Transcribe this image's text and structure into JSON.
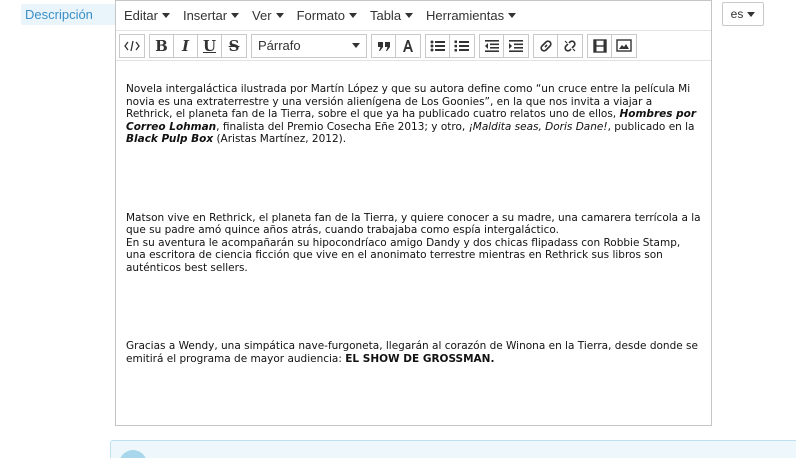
{
  "field_label": "Descripción",
  "menubar": {
    "items": [
      "Editar",
      "Insertar",
      "Ver",
      "Formato",
      "Tabla",
      "Herramientas"
    ]
  },
  "toolbar": {
    "source_code": "source-code-icon",
    "bold": "B",
    "italic": "I",
    "underline": "U",
    "strike": "S",
    "block_format": "Párrafo"
  },
  "content": {
    "p1": {
      "s1": "Novela intergaláctica ilustrada por Martín López y que su autora define como “un cruce entre la película Mi novia es una extraterrestre y una versión alienígena de Los Goonies”, en la que nos invita a viajar a Rethrick, el planeta fan de la Tierra, sobre el que ya ha publicado cuatro relatos uno de ellos, ",
      "b1": "Hombres por Correo Lohman",
      "s2": ", finalista del Premio Cosecha Eñe 2013; y otro, ",
      "i1": "¡Maldita seas, Doris Dane!",
      "s3": ", publicado en la ",
      "b2": "Black Pulp Box",
      "s4": " (Aristas Martínez, 2012)."
    },
    "p2": "Matson vive en Rethrick, el planeta fan de la Tierra, y quiere conocer a su madre, una camarera terrícola a la que su padre amó quince años atrás, cuando trabajaba como espía intergaláctico.",
    "p2b": "En su aventura le acompañarán su hipocondríaco amigo Dandy y dos chicas flipadass con Robbie Stamp, una escritora de ciencia ficción que vive en el anonimato terrestre mientras en Rethrick sus libros son auténticos best sellers.",
    "p3": {
      "s1": "Gracias a Wendy, una simpática nave-furgoneta, llegarán al corazón de Winona en la Tierra, desde donde se emitirá el programa de mayor audiencia: ",
      "b1": "EL SHOW DE GROSSMAN."
    }
  },
  "language": "es",
  "colors": {
    "label_bg": "#eaf4fb",
    "label_text": "#3a8fc7",
    "info_bg": "#eef7fb"
  }
}
